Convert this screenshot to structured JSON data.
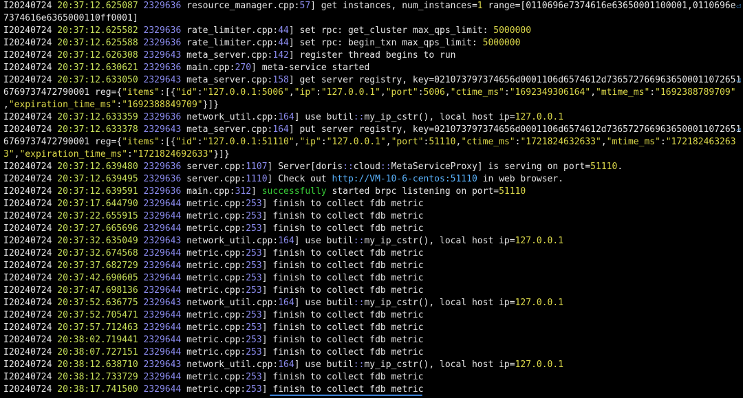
{
  "terminal": {
    "lines": [
      [
        {
          "t": "I20240724 "
        },
        {
          "t": "20:37:12.625087",
          "c": "ts"
        },
        {
          "t": " "
        },
        {
          "t": "2329636",
          "c": "tid"
        },
        {
          "t": " resource_manager.cpp:"
        },
        {
          "t": "57",
          "c": "ln"
        },
        {
          "t": "] get instances, num_instances="
        },
        {
          "t": "1",
          "c": "num"
        },
        {
          "t": " range=[0110696e7374616e63650001100001,0110696e"
        }
      ],
      [
        {
          "t": "7374616e6365000110ff0001]"
        }
      ],
      [
        {
          "t": "I20240724 "
        },
        {
          "t": "20:37:12.625582",
          "c": "ts"
        },
        {
          "t": " "
        },
        {
          "t": "2329636",
          "c": "tid"
        },
        {
          "t": " rate_limiter.cpp:"
        },
        {
          "t": "44",
          "c": "ln"
        },
        {
          "t": "] set rpc: get_cluster max_qps_limit: "
        },
        {
          "t": "5000000",
          "c": "num"
        }
      ],
      [
        {
          "t": "I20240724 "
        },
        {
          "t": "20:37:12.625588",
          "c": "ts"
        },
        {
          "t": " "
        },
        {
          "t": "2329636",
          "c": "tid"
        },
        {
          "t": " rate_limiter.cpp:"
        },
        {
          "t": "44",
          "c": "ln"
        },
        {
          "t": "] set rpc: begin_txn max_qps_limit: "
        },
        {
          "t": "5000000",
          "c": "num"
        }
      ],
      [
        {
          "t": "I20240724 "
        },
        {
          "t": "20:37:12.626308",
          "c": "ts"
        },
        {
          "t": " "
        },
        {
          "t": "2329643",
          "c": "tid"
        },
        {
          "t": " meta_server.cpp:"
        },
        {
          "t": "142",
          "c": "ln"
        },
        {
          "t": "] register thread begins to run"
        }
      ],
      [
        {
          "t": "I20240724 "
        },
        {
          "t": "20:37:12.630621",
          "c": "ts"
        },
        {
          "t": " "
        },
        {
          "t": "2329636",
          "c": "tid"
        },
        {
          "t": " main.cpp:"
        },
        {
          "t": "270",
          "c": "ln"
        },
        {
          "t": "] meta-service started"
        }
      ],
      [
        {
          "t": "I20240724 "
        },
        {
          "t": "20:37:12.633050",
          "c": "ts"
        },
        {
          "t": " "
        },
        {
          "t": "2329643",
          "c": "tid"
        },
        {
          "t": " meta_server.cpp:"
        },
        {
          "t": "158",
          "c": "ln"
        },
        {
          "t": "] get server registry, key=021073797374656d0001106d6574612d7365727669636500011072651"
        }
      ],
      [
        {
          "t": "6769737472790001 reg={"
        },
        {
          "t": "\"items\"",
          "c": "str"
        },
        {
          "t": ":[{"
        },
        {
          "t": "\"id\"",
          "c": "str"
        },
        {
          "t": ":"
        },
        {
          "t": "\"127.0.0.1:5006\"",
          "c": "str"
        },
        {
          "t": ","
        },
        {
          "t": "\"ip\"",
          "c": "str"
        },
        {
          "t": ":"
        },
        {
          "t": "\"127.0.0.1\"",
          "c": "str"
        },
        {
          "t": ","
        },
        {
          "t": "\"port\"",
          "c": "str"
        },
        {
          "t": ":"
        },
        {
          "t": "5006",
          "c": "num"
        },
        {
          "t": ","
        },
        {
          "t": "\"ctime_ms\"",
          "c": "str"
        },
        {
          "t": ":"
        },
        {
          "t": "\"1692349306164\"",
          "c": "str"
        },
        {
          "t": ","
        },
        {
          "t": "\"mtime_ms\"",
          "c": "str"
        },
        {
          "t": ":"
        },
        {
          "t": "\"1692388789709\"",
          "c": "str"
        }
      ],
      [
        {
          "t": ","
        },
        {
          "t": "\"expiration_time_ms\"",
          "c": "str"
        },
        {
          "t": ":"
        },
        {
          "t": "\"1692388849709\"",
          "c": "str"
        },
        {
          "t": "}]}"
        }
      ],
      [
        {
          "t": "I20240724 "
        },
        {
          "t": "20:37:12.633359",
          "c": "ts"
        },
        {
          "t": " "
        },
        {
          "t": "2329636",
          "c": "tid"
        },
        {
          "t": " network_util.cpp:"
        },
        {
          "t": "164",
          "c": "ln"
        },
        {
          "t": "] use butil"
        },
        {
          "t": "::",
          "c": "op"
        },
        {
          "t": "my_ip_cstr(), local host ip="
        },
        {
          "t": "127.0.0.1",
          "c": "num"
        }
      ],
      [
        {
          "t": "I20240724 "
        },
        {
          "t": "20:37:12.633378",
          "c": "ts"
        },
        {
          "t": " "
        },
        {
          "t": "2329643",
          "c": "tid"
        },
        {
          "t": " meta_server.cpp:"
        },
        {
          "t": "164",
          "c": "ln"
        },
        {
          "t": "] put server registry, key=021073797374656d0001106d6574612d7365727669636500011072651"
        }
      ],
      [
        {
          "t": "6769737472790001 reg={"
        },
        {
          "t": "\"items\"",
          "c": "str"
        },
        {
          "t": ":[{"
        },
        {
          "t": "\"id\"",
          "c": "str"
        },
        {
          "t": ":"
        },
        {
          "t": "\"127.0.0.1:51110\"",
          "c": "str"
        },
        {
          "t": ","
        },
        {
          "t": "\"ip\"",
          "c": "str"
        },
        {
          "t": ":"
        },
        {
          "t": "\"127.0.0.1\"",
          "c": "str"
        },
        {
          "t": ","
        },
        {
          "t": "\"port\"",
          "c": "str"
        },
        {
          "t": ":"
        },
        {
          "t": "51110",
          "c": "num"
        },
        {
          "t": ","
        },
        {
          "t": "\"ctime_ms\"",
          "c": "str"
        },
        {
          "t": ":"
        },
        {
          "t": "\"1721824632633\"",
          "c": "str"
        },
        {
          "t": ","
        },
        {
          "t": "\"mtime_ms\"",
          "c": "str"
        },
        {
          "t": ":"
        },
        {
          "t": "\"172182463263",
          "c": "str"
        }
      ],
      [
        {
          "t": "3\"",
          "c": "str"
        },
        {
          "t": ","
        },
        {
          "t": "\"expiration_time_ms\"",
          "c": "str"
        },
        {
          "t": ":"
        },
        {
          "t": "\"1721824692633\"",
          "c": "str"
        },
        {
          "t": "}]}"
        }
      ],
      [
        {
          "t": "I20240724 "
        },
        {
          "t": "20:37:12.639480",
          "c": "ts"
        },
        {
          "t": " "
        },
        {
          "t": "2329636",
          "c": "tid"
        },
        {
          "t": " server.cpp:"
        },
        {
          "t": "1107",
          "c": "ln"
        },
        {
          "t": "] Server[doris"
        },
        {
          "t": "::",
          "c": "op"
        },
        {
          "t": "cloud"
        },
        {
          "t": "::",
          "c": "op"
        },
        {
          "t": "MetaServiceProxy] is serving on port="
        },
        {
          "t": "51110",
          "c": "num"
        },
        {
          "t": "."
        }
      ],
      [
        {
          "t": "I20240724 "
        },
        {
          "t": "20:37:12.639495",
          "c": "ts"
        },
        {
          "t": " "
        },
        {
          "t": "2329636",
          "c": "tid"
        },
        {
          "t": " server.cpp:"
        },
        {
          "t": "1110",
          "c": "ln"
        },
        {
          "t": "] Check out "
        },
        {
          "t": "http://VM-10-6-centos:51110",
          "c": "url"
        },
        {
          "t": " in web browser."
        }
      ],
      [
        {
          "t": "I20240724 "
        },
        {
          "t": "20:37:12.639591",
          "c": "ts"
        },
        {
          "t": " "
        },
        {
          "t": "2329636",
          "c": "tid"
        },
        {
          "t": " main.cpp:"
        },
        {
          "t": "312",
          "c": "ln"
        },
        {
          "t": "] "
        },
        {
          "t": "successfully",
          "c": "green"
        },
        {
          "t": " started brpc listening on port="
        },
        {
          "t": "51110",
          "c": "num"
        }
      ],
      [
        {
          "t": "I20240724 "
        },
        {
          "t": "20:37:17.644790",
          "c": "ts"
        },
        {
          "t": " "
        },
        {
          "t": "2329644",
          "c": "tid"
        },
        {
          "t": " metric.cpp:"
        },
        {
          "t": "253",
          "c": "ln"
        },
        {
          "t": "] finish to collect fdb metric"
        }
      ],
      [
        {
          "t": "I20240724 "
        },
        {
          "t": "20:37:22.655915",
          "c": "ts"
        },
        {
          "t": " "
        },
        {
          "t": "2329644",
          "c": "tid"
        },
        {
          "t": " metric.cpp:"
        },
        {
          "t": "253",
          "c": "ln"
        },
        {
          "t": "] finish to collect fdb metric"
        }
      ],
      [
        {
          "t": "I20240724 "
        },
        {
          "t": "20:37:27.665696",
          "c": "ts"
        },
        {
          "t": " "
        },
        {
          "t": "2329644",
          "c": "tid"
        },
        {
          "t": " metric.cpp:"
        },
        {
          "t": "253",
          "c": "ln"
        },
        {
          "t": "] finish to collect fdb metric"
        }
      ],
      [
        {
          "t": "I20240724 "
        },
        {
          "t": "20:37:32.635049",
          "c": "ts"
        },
        {
          "t": " "
        },
        {
          "t": "2329643",
          "c": "tid"
        },
        {
          "t": " network_util.cpp:"
        },
        {
          "t": "164",
          "c": "ln"
        },
        {
          "t": "] use butil"
        },
        {
          "t": "::",
          "c": "op"
        },
        {
          "t": "my_ip_cstr(), local host ip="
        },
        {
          "t": "127.0.0.1",
          "c": "num"
        }
      ],
      [
        {
          "t": "I20240724 "
        },
        {
          "t": "20:37:32.674568",
          "c": "ts"
        },
        {
          "t": " "
        },
        {
          "t": "2329644",
          "c": "tid"
        },
        {
          "t": " metric.cpp:"
        },
        {
          "t": "253",
          "c": "ln"
        },
        {
          "t": "] finish to collect fdb metric"
        }
      ],
      [
        {
          "t": "I20240724 "
        },
        {
          "t": "20:37:37.682729",
          "c": "ts"
        },
        {
          "t": " "
        },
        {
          "t": "2329644",
          "c": "tid"
        },
        {
          "t": " metric.cpp:"
        },
        {
          "t": "253",
          "c": "ln"
        },
        {
          "t": "] finish to collect fdb metric"
        }
      ],
      [
        {
          "t": "I20240724 "
        },
        {
          "t": "20:37:42.690605",
          "c": "ts"
        },
        {
          "t": " "
        },
        {
          "t": "2329644",
          "c": "tid"
        },
        {
          "t": " metric.cpp:"
        },
        {
          "t": "253",
          "c": "ln"
        },
        {
          "t": "] finish to collect fdb metric"
        }
      ],
      [
        {
          "t": "I20240724 "
        },
        {
          "t": "20:37:47.698136",
          "c": "ts"
        },
        {
          "t": " "
        },
        {
          "t": "2329644",
          "c": "tid"
        },
        {
          "t": " metric.cpp:"
        },
        {
          "t": "253",
          "c": "ln"
        },
        {
          "t": "] finish to collect fdb metric"
        }
      ],
      [
        {
          "t": "I20240724 "
        },
        {
          "t": "20:37:52.636775",
          "c": "ts"
        },
        {
          "t": " "
        },
        {
          "t": "2329643",
          "c": "tid"
        },
        {
          "t": " network_util.cpp:"
        },
        {
          "t": "164",
          "c": "ln"
        },
        {
          "t": "] use butil"
        },
        {
          "t": "::",
          "c": "op"
        },
        {
          "t": "my_ip_cstr(), local host ip="
        },
        {
          "t": "127.0.0.1",
          "c": "num"
        }
      ],
      [
        {
          "t": "I20240724 "
        },
        {
          "t": "20:37:52.705471",
          "c": "ts"
        },
        {
          "t": " "
        },
        {
          "t": "2329644",
          "c": "tid"
        },
        {
          "t": " metric.cpp:"
        },
        {
          "t": "253",
          "c": "ln"
        },
        {
          "t": "] finish to collect fdb metric"
        }
      ],
      [
        {
          "t": "I20240724 "
        },
        {
          "t": "20:37:57.712463",
          "c": "ts"
        },
        {
          "t": " "
        },
        {
          "t": "2329644",
          "c": "tid"
        },
        {
          "t": " metric.cpp:"
        },
        {
          "t": "253",
          "c": "ln"
        },
        {
          "t": "] finish to collect fdb metric"
        }
      ],
      [
        {
          "t": "I20240724 "
        },
        {
          "t": "20:38:02.719441",
          "c": "ts"
        },
        {
          "t": " "
        },
        {
          "t": "2329644",
          "c": "tid"
        },
        {
          "t": " metric.cpp:"
        },
        {
          "t": "253",
          "c": "ln"
        },
        {
          "t": "] finish to collect fdb metric"
        }
      ],
      [
        {
          "t": "I20240724 "
        },
        {
          "t": "20:38:07.727151",
          "c": "ts"
        },
        {
          "t": " "
        },
        {
          "t": "2329644",
          "c": "tid"
        },
        {
          "t": " metric.cpp:"
        },
        {
          "t": "253",
          "c": "ln"
        },
        {
          "t": "] finish to collect fdb metric"
        }
      ],
      [
        {
          "t": "I20240724 "
        },
        {
          "t": "20:38:12.638710",
          "c": "ts"
        },
        {
          "t": " "
        },
        {
          "t": "2329643",
          "c": "tid"
        },
        {
          "t": " network_util.cpp:"
        },
        {
          "t": "164",
          "c": "ln"
        },
        {
          "t": "] use butil"
        },
        {
          "t": "::",
          "c": "op"
        },
        {
          "t": "my_ip_cstr(), local host ip="
        },
        {
          "t": "127.0.0.1",
          "c": "num"
        }
      ],
      [
        {
          "t": "I20240724 "
        },
        {
          "t": "20:38:12.733729",
          "c": "ts"
        },
        {
          "t": " "
        },
        {
          "t": "2329644",
          "c": "tid"
        },
        {
          "t": " metric.cpp:"
        },
        {
          "t": "253",
          "c": "ln"
        },
        {
          "t": "] finish to collect fdb metric"
        }
      ],
      [
        {
          "t": "I20240724 "
        },
        {
          "t": "20:38:17.741500",
          "c": "ts"
        },
        {
          "t": " "
        },
        {
          "t": "2329644",
          "c": "tid"
        },
        {
          "t": " metric.cpp:"
        },
        {
          "t": "253",
          "c": "ln"
        },
        {
          "t": "] finish to collect fdb metric"
        }
      ]
    ],
    "wrap_marker_glyph": "⏎",
    "wrapped_line_indices": [
      0,
      6,
      10
    ],
    "highlighted_line_text": "finish to collect fdb metric",
    "colors": {
      "background": "#000000",
      "text": "#e6e6e6",
      "timestamp": "#c8e05a",
      "thread_id": "#8c8cf0",
      "number_value": "#dcd94a",
      "success": "#37c836",
      "url": "#5ab4ff",
      "annotation_underline": "#3b82d8"
    }
  }
}
